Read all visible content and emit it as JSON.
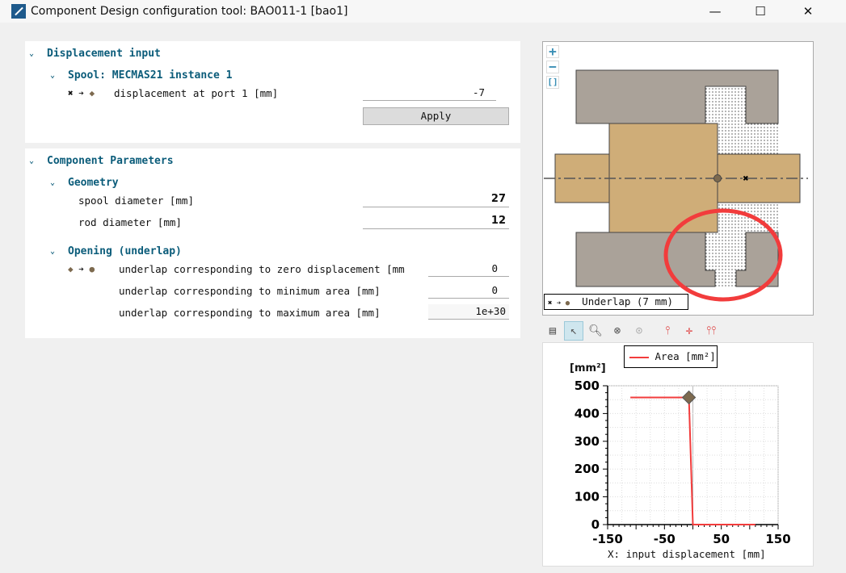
{
  "window": {
    "title": "Component Design configuration tool: BAO011-1 [bao1]",
    "minimize": "—",
    "maximize": "☐",
    "close": "✕"
  },
  "displacement_input": {
    "title": "Displacement input",
    "spool": "Spool: MECMAS21 instance 1",
    "port_label": "displacement at port 1 [mm]",
    "port_value": "-7",
    "apply": "Apply"
  },
  "component_parameters": {
    "title": "Component Parameters",
    "geometry": {
      "title": "Geometry",
      "spool_diameter_label": "spool diameter [mm]",
      "spool_diameter": "27",
      "rod_diameter_label": "rod diameter [mm]",
      "rod_diameter": "12"
    },
    "opening": {
      "title": "Opening (underlap)",
      "rows": [
        {
          "label": "underlap corresponding to zero displacement [mm",
          "value": "0"
        },
        {
          "label": "underlap corresponding to minimum area [mm]",
          "value": "0"
        },
        {
          "label": "underlap corresponding to maximum area [mm]",
          "value": "1e+30"
        }
      ]
    }
  },
  "diagram": {
    "legend": "Underlap (7 mm)",
    "zoom_in": "+",
    "zoom_out": "−",
    "fit": "[]",
    "colors": {
      "body": "#aaa299",
      "spool": "#cfad78",
      "highlight": "#f23c3c"
    }
  },
  "toolbar": {
    "icons": [
      "table-icon",
      "pointer-icon",
      "zoom-region-icon",
      "zoom-fit-icon",
      "zoom-reset-icon",
      "marker-icon",
      "crosshair-icon",
      "dual-marker-icon"
    ]
  },
  "chart_data": {
    "type": "line",
    "legend": "Area [mm²]",
    "ylabel": "[mm²]",
    "xlabel": "X: input displacement [mm]",
    "xlim": [
      -150,
      150
    ],
    "ylim": [
      0,
      500
    ],
    "xticks": [
      "-150",
      "-50",
      "50",
      "150"
    ],
    "yticks": [
      "0",
      "100",
      "200",
      "300",
      "400",
      "500"
    ],
    "series": [
      {
        "name": "Area [mm²]",
        "color": "#f23c3c",
        "x": [
          -110,
          -7,
          0,
          110
        ],
        "y": [
          458,
          458,
          0,
          0
        ]
      }
    ],
    "marker": {
      "x": -7,
      "y": 458,
      "color": "#7d6a4f"
    },
    "grid": true
  }
}
